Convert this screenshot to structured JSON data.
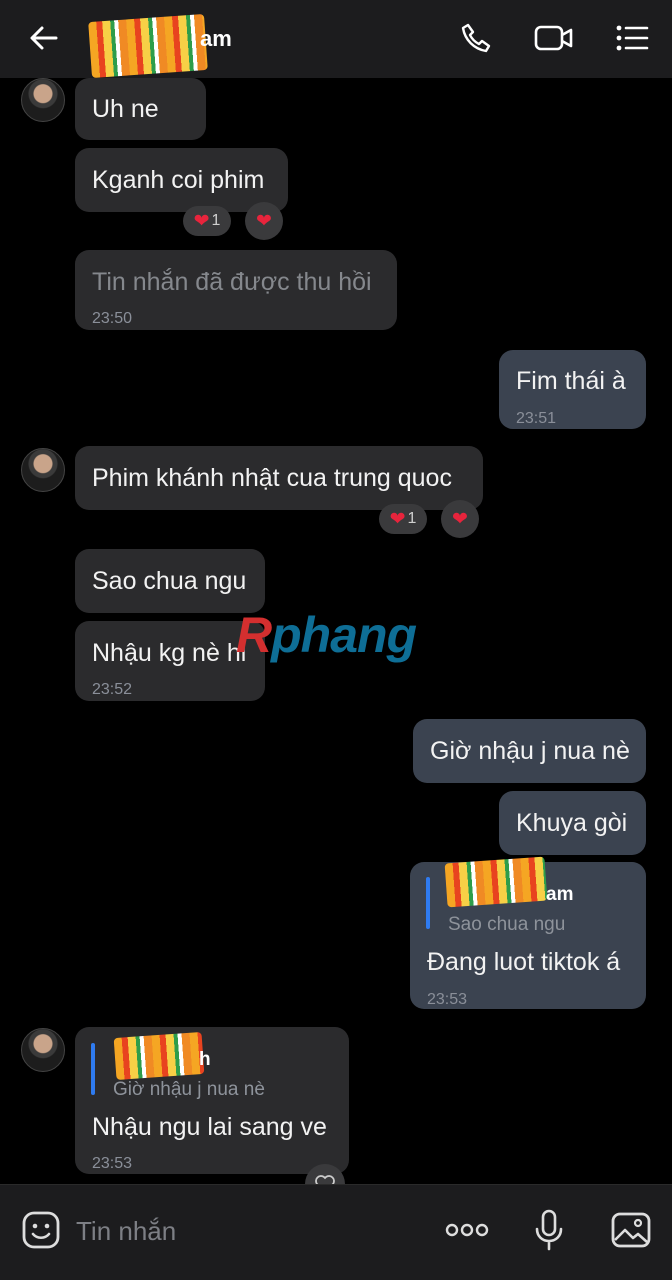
{
  "header": {
    "contact_name_suffix": "am"
  },
  "messages": [
    {
      "text": "Uh ne"
    },
    {
      "text": "Kganh coi phim",
      "reaction_count": "1"
    },
    {
      "text": "Tin nhắn đã được thu hồi",
      "time": "23:50"
    },
    {
      "text": "Fim thái à",
      "time": "23:51"
    },
    {
      "text": "Phim khánh nhật cua trung quoc",
      "reaction_count": "1"
    },
    {
      "text": "Sao chua ngu"
    },
    {
      "text": "Nhậu kg nè hi",
      "time": "23:52"
    },
    {
      "text": "Giờ nhậu j nua nè"
    },
    {
      "text": "Khuya gòi"
    },
    {
      "reply_name_suffix": "am",
      "reply_quote": "Sao chua ngu",
      "text": "Đang luot tiktok á",
      "time": "23:53"
    },
    {
      "reply_name_suffix": "h",
      "reply_quote": "Giờ nhậu j nua nè",
      "text": "Nhậu ngu lai sang ve",
      "time": "23:53"
    }
  ],
  "watermark": {
    "first": "R",
    "rest": "phang"
  },
  "composer": {
    "placeholder": "Tin nhắn"
  },
  "colors": {
    "incoming": "#2b2b2d",
    "outgoing": "#3b4350",
    "heart": "#e8243c",
    "reply_bar": "#2f7bf0"
  },
  "icons": [
    "back-arrow-icon",
    "phone-icon",
    "video-call-icon",
    "menu-list-icon",
    "sticker-icon",
    "more-icon",
    "microphone-icon",
    "image-icon",
    "heart-icon"
  ]
}
